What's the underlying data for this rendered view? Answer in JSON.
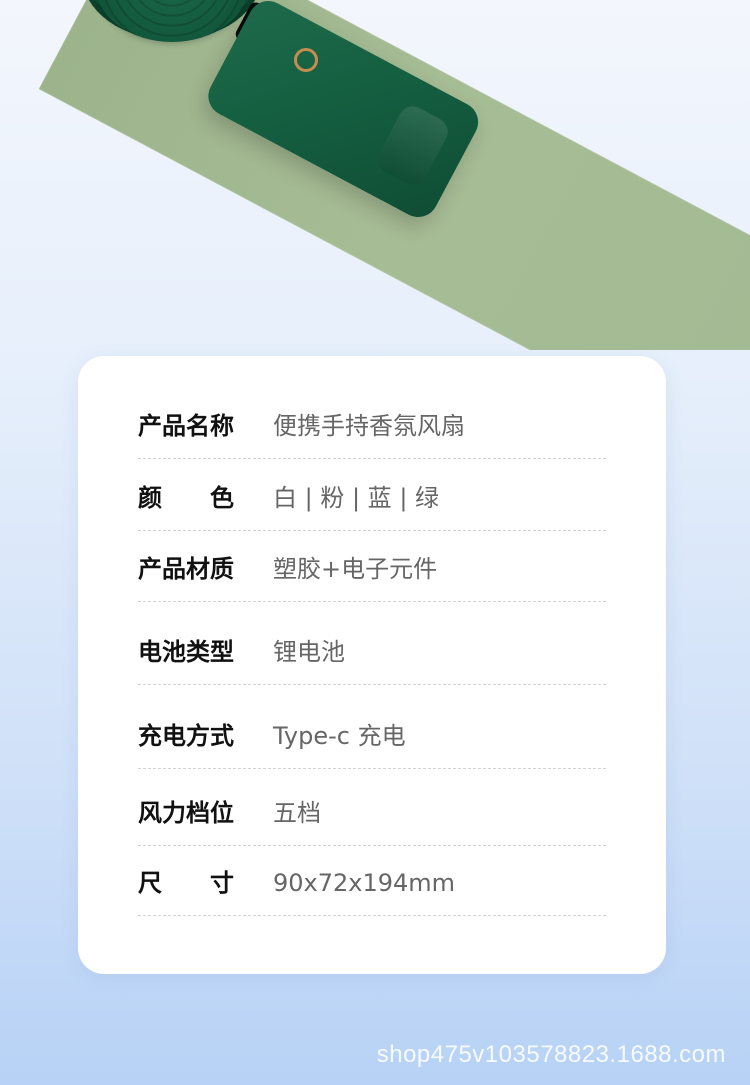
{
  "specs": [
    {
      "label": "产品名称",
      "value": "便携手持香氛风扇"
    },
    {
      "label": "颜　　色",
      "value": "白 | 粉 | 蓝 | 绿"
    },
    {
      "label": "产品材质",
      "value": "塑胶+电子元件"
    },
    {
      "label": "电池类型",
      "value": "锂电池"
    },
    {
      "label": "充电方式",
      "value": "Type-c 充电"
    },
    {
      "label": "风力档位",
      "value": "五档"
    },
    {
      "label": "尺　　寸",
      "value": "90x72x194mm"
    }
  ],
  "watermark": "shop475v103578823.1688.com"
}
